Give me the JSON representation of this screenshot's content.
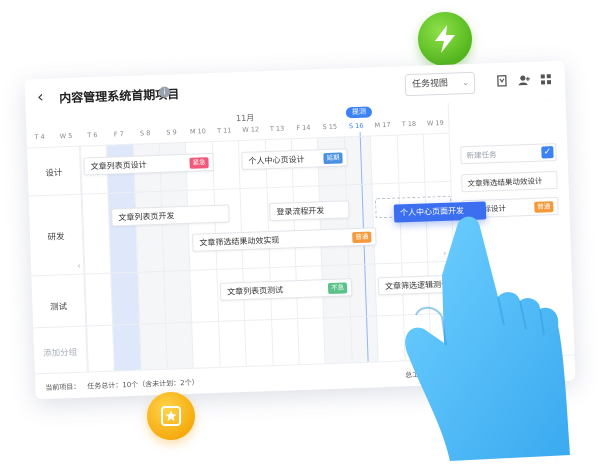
{
  "header": {
    "title": "内容管理系统首期项目",
    "view_select": "任务视图",
    "back_icon": "arrow-left-icon",
    "info_icon": "info-icon",
    "icons": [
      "bookmark-icon",
      "add-user-icon",
      "grid-icon"
    ]
  },
  "timeline": {
    "month": "11月",
    "today_label": "提测",
    "days": [
      "T 4",
      "W 5",
      "T 6",
      "F 7",
      "S 8",
      "S 9",
      "M 10",
      "T 11",
      "W 12",
      "T 13",
      "F 14",
      "S 15",
      "S 16",
      "M 17",
      "T 18",
      "W 19"
    ]
  },
  "rows": {
    "design": "设计",
    "dev": "研发",
    "test": "测试",
    "add_group": "添加分组"
  },
  "tasks": {
    "t1": {
      "label": "文章列表页设计",
      "tag": "紧急"
    },
    "t2": {
      "label": "个人中心页设计",
      "tag": "延期"
    },
    "t3": {
      "label": "文章列表页开发"
    },
    "t4": {
      "label": "登录流程开发"
    },
    "t5": {
      "label": "文章筛选结果动效实现",
      "tag": "普通"
    },
    "t6": {
      "label": "个人中心页面开发"
    },
    "t7": {
      "label": "文章列表页测试",
      "tag": "不急"
    },
    "t8": {
      "label": "文章筛选逻辑测试"
    }
  },
  "sidebar": {
    "new_task_placeholder": "新建任务",
    "item1": "文章筛选结果动效设计",
    "item2": "小图标设计",
    "item2_tag": "普通"
  },
  "footer": {
    "current": "当前项目：",
    "total": "任务总计：10个（含未计划：2个）",
    "hours": "总工时：14天"
  },
  "colors": {
    "accent": "#3b82f6",
    "tag_urgent": "#f0597a",
    "tag_delay": "#4a90e2",
    "tag_normal": "#f59a3c",
    "tag_low": "#5cc28a",
    "bolt_badge": "#5cc22a",
    "star_badge": "#f7b21a"
  }
}
